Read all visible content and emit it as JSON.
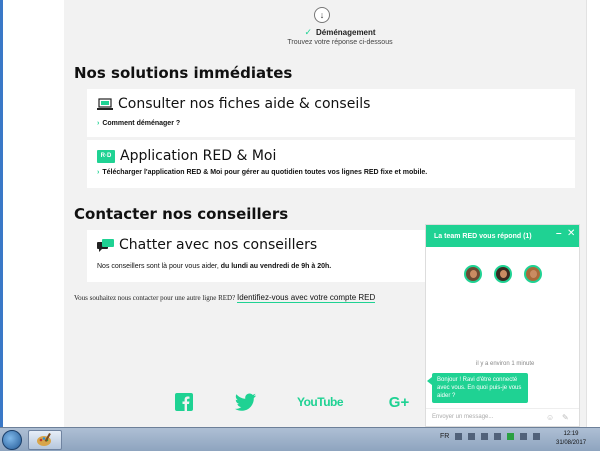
{
  "step": {
    "title": "Déménagement",
    "subtitle": "Trouvez votre réponse ci-dessous"
  },
  "solutions": {
    "heading": "Nos solutions immédiates",
    "cards": [
      {
        "title": "Consulter nos fiches aide & conseils",
        "link": "Comment déménager ?"
      },
      {
        "title": "Application RED & Moi",
        "logo": "R·D",
        "link": "Télécharger l'application RED & Moi pour gérer au quotidien toutes vos lignes RED fixe et mobile."
      }
    ]
  },
  "contact": {
    "heading": "Contacter nos conseillers",
    "chat_card": {
      "title": "Chatter avec nos conseillers",
      "text_plain": "Nos conseillers sont là pour vous aider, ",
      "text_bold": "du lundi au vendredi de 9h à 20h."
    },
    "other_line_text": "Vous souhaitez nous contacter pour une autre ligne RED?",
    "other_line_link": "Identifiez-vous avec votre compte RED"
  },
  "social": [
    "facebook-icon",
    "twitter-icon",
    "youtube-icon",
    "google-plus-icon"
  ],
  "social_labels": {
    "youtube": "YouTube",
    "gplus": "G+"
  },
  "chat_widget": {
    "header": "La team RED vous répond (1)",
    "time": "il y a environ 1 minute",
    "message": "Bonjour ! Ravi d'être connecté avec vous. En quoi puis-je vous aider ?",
    "input_placeholder": "Envoyer un message..."
  },
  "taskbar": {
    "language": "FR",
    "time": "12:19",
    "date": "31/08/2017"
  },
  "colors": {
    "accent": "#1fd293"
  }
}
